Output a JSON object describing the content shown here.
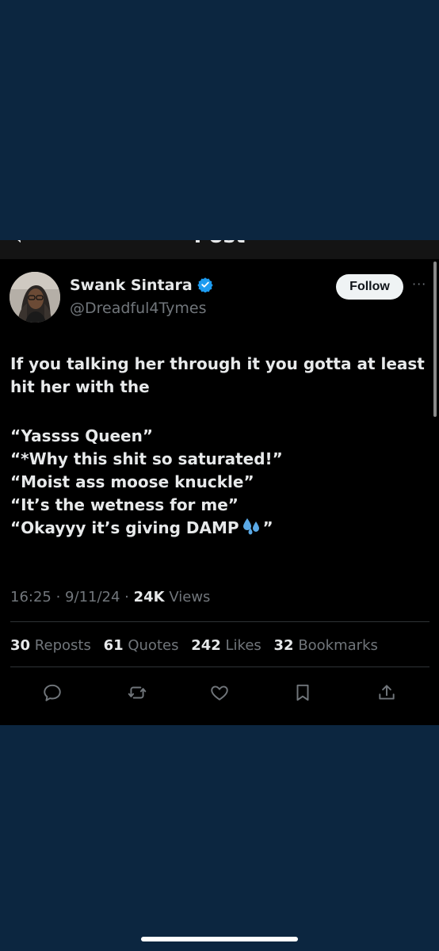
{
  "header": {
    "title": "Post",
    "back_icon": "back-arrow-icon"
  },
  "author": {
    "name": "Swank Sintara",
    "handle": "@Dreadful4Tymes",
    "verified": true,
    "verified_color": "#1d9bf0"
  },
  "follow_label": "Follow",
  "more_icon": "more-options-icon",
  "post": {
    "line1": "If you talking her through it you gotta at least hit her with the",
    "quote1": "“Yassss Queen”",
    "quote2": "“*Why this shit so saturated!”",
    "quote3": "“Moist ass moose knuckle”",
    "quote4": "“It’s the wetness for me”",
    "quote5_text": "“Okayyy it’s giving DAMP",
    "quote5_emoji": "sweat-droplets-emoji",
    "quote5_end": "”"
  },
  "meta": {
    "time": "16:25",
    "sep1": " · ",
    "date": "9/11/24",
    "sep2": " · ",
    "views_count": "24K",
    "views_label": " Views"
  },
  "stats": {
    "reposts_count": "30",
    "reposts_label": "Reposts",
    "quotes_count": "61",
    "quotes_label": "Quotes",
    "likes_count": "242",
    "likes_label": "Likes",
    "bookmarks_count": "32",
    "bookmarks_label": "Bookmarks"
  },
  "actions": [
    "reply-icon",
    "repost-icon",
    "like-icon",
    "bookmark-icon",
    "share-icon"
  ],
  "colors": {
    "outer_background": "#0c2640",
    "post_background": "#000000",
    "text_primary": "#e7e9ea",
    "text_secondary": "#71767b",
    "divider": "#2f3336"
  }
}
